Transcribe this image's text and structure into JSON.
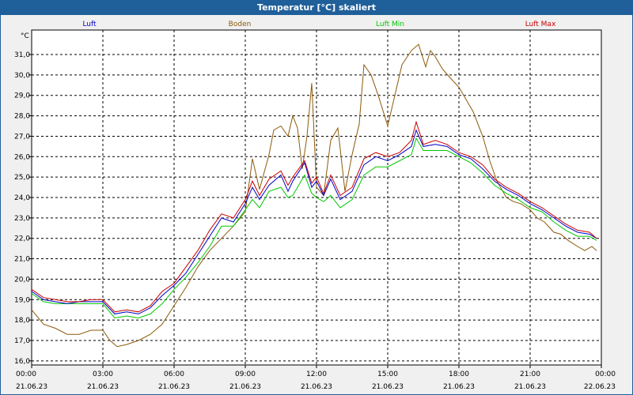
{
  "window": {
    "title": "Temperatur [°C] skaliert"
  },
  "chart_data": {
    "type": "line",
    "title": "Temperatur [°C] skaliert",
    "ylabel": "°C",
    "xlabel": "",
    "ylim": [
      15.8,
      32.2
    ],
    "xlim": [
      0,
      24
    ],
    "grid": true,
    "legend_placement": "top",
    "yticks": [
      "16,0",
      "17,0",
      "18,0",
      "19,0",
      "20,0",
      "21,0",
      "22,0",
      "23,0",
      "24,0",
      "25,0",
      "26,0",
      "27,0",
      "28,0",
      "29,0",
      "30,0",
      "31,0"
    ],
    "xticks": [
      {
        "time": "00:00",
        "date": "21.06.23",
        "h": 0
      },
      {
        "time": "03:00",
        "date": "21.06.23",
        "h": 3
      },
      {
        "time": "06:00",
        "date": "21.06.23",
        "h": 6
      },
      {
        "time": "09:00",
        "date": "21.06.23",
        "h": 9
      },
      {
        "time": "12:00",
        "date": "21.06.23",
        "h": 12
      },
      {
        "time": "15:00",
        "date": "21.06.23",
        "h": 15
      },
      {
        "time": "18:00",
        "date": "21.06.23",
        "h": 18
      },
      {
        "time": "21:00",
        "date": "21.06.23",
        "h": 21
      },
      {
        "time": "00:00",
        "date": "22.06.23",
        "h": 24
      }
    ],
    "series": [
      {
        "name": "Luft",
        "color": "#0000c8",
        "points": [
          [
            0,
            19.4
          ],
          [
            0.5,
            19.0
          ],
          [
            1,
            18.9
          ],
          [
            1.5,
            18.8
          ],
          [
            2,
            18.9
          ],
          [
            2.5,
            18.9
          ],
          [
            3,
            18.9
          ],
          [
            3.5,
            18.3
          ],
          [
            4,
            18.4
          ],
          [
            4.5,
            18.3
          ],
          [
            5,
            18.6
          ],
          [
            5.5,
            19.2
          ],
          [
            6,
            19.7
          ],
          [
            6.5,
            20.3
          ],
          [
            7,
            21.2
          ],
          [
            7.5,
            22.1
          ],
          [
            8,
            23.0
          ],
          [
            8.5,
            22.8
          ],
          [
            9,
            23.7
          ],
          [
            9.3,
            24.5
          ],
          [
            9.6,
            23.9
          ],
          [
            10,
            24.6
          ],
          [
            10.5,
            25.1
          ],
          [
            10.8,
            24.3
          ],
          [
            11,
            24.8
          ],
          [
            11.5,
            25.7
          ],
          [
            11.8,
            24.5
          ],
          [
            12,
            24.8
          ],
          [
            12.3,
            24.1
          ],
          [
            12.6,
            24.9
          ],
          [
            13,
            23.9
          ],
          [
            13.5,
            24.3
          ],
          [
            14,
            25.6
          ],
          [
            14.5,
            26.0
          ],
          [
            15,
            25.8
          ],
          [
            15.5,
            26.1
          ],
          [
            16,
            26.5
          ],
          [
            16.2,
            27.3
          ],
          [
            16.5,
            26.5
          ],
          [
            17,
            26.6
          ],
          [
            17.5,
            26.5
          ],
          [
            18,
            26.1
          ],
          [
            18.5,
            25.9
          ],
          [
            19,
            25.4
          ],
          [
            19.5,
            24.8
          ],
          [
            20,
            24.4
          ],
          [
            20.5,
            24.1
          ],
          [
            21,
            23.7
          ],
          [
            21.5,
            23.4
          ],
          [
            22,
            23.0
          ],
          [
            22.5,
            22.6
          ],
          [
            23,
            22.3
          ],
          [
            23.5,
            22.2
          ],
          [
            23.8,
            22.0
          ]
        ]
      },
      {
        "name": "Boden",
        "color": "#8b5a0a",
        "points": [
          [
            0,
            18.5
          ],
          [
            0.5,
            17.8
          ],
          [
            1,
            17.6
          ],
          [
            1.5,
            17.3
          ],
          [
            2,
            17.3
          ],
          [
            2.5,
            17.5
          ],
          [
            3,
            17.5
          ],
          [
            3.3,
            17.0
          ],
          [
            3.6,
            16.7
          ],
          [
            4,
            16.8
          ],
          [
            4.5,
            17.0
          ],
          [
            5,
            17.3
          ],
          [
            5.5,
            17.8
          ],
          [
            6,
            18.7
          ],
          [
            6.5,
            19.6
          ],
          [
            7,
            20.6
          ],
          [
            7.5,
            21.4
          ],
          [
            8,
            22.0
          ],
          [
            8.5,
            22.6
          ],
          [
            9,
            23.3
          ],
          [
            9.3,
            25.9
          ],
          [
            9.6,
            24.4
          ],
          [
            10,
            26.1
          ],
          [
            10.2,
            27.3
          ],
          [
            10.5,
            27.5
          ],
          [
            10.8,
            27.0
          ],
          [
            11,
            28.0
          ],
          [
            11.2,
            27.4
          ],
          [
            11.4,
            25.4
          ],
          [
            11.6,
            27.0
          ],
          [
            11.8,
            29.6
          ],
          [
            12,
            24.5
          ],
          [
            12.3,
            24.1
          ],
          [
            12.6,
            26.8
          ],
          [
            12.9,
            27.4
          ],
          [
            13.2,
            24.3
          ],
          [
            13.5,
            26.1
          ],
          [
            13.8,
            27.6
          ],
          [
            14,
            30.5
          ],
          [
            14.3,
            30.0
          ],
          [
            14.6,
            29.0
          ],
          [
            15,
            27.5
          ],
          [
            15.3,
            29.0
          ],
          [
            15.6,
            30.5
          ],
          [
            16,
            31.2
          ],
          [
            16.3,
            31.5
          ],
          [
            16.6,
            30.4
          ],
          [
            16.8,
            31.2
          ],
          [
            17.0,
            30.9
          ],
          [
            17.3,
            30.3
          ],
          [
            17.6,
            29.9
          ],
          [
            18,
            29.4
          ],
          [
            18.3,
            28.8
          ],
          [
            18.6,
            28.2
          ],
          [
            19,
            27.0
          ],
          [
            19.3,
            25.8
          ],
          [
            19.6,
            24.8
          ],
          [
            20,
            24.0
          ],
          [
            20.3,
            23.8
          ],
          [
            20.6,
            23.7
          ],
          [
            21,
            23.4
          ],
          [
            21.3,
            23.0
          ],
          [
            21.6,
            22.8
          ],
          [
            22,
            22.3
          ],
          [
            22.3,
            22.2
          ],
          [
            22.6,
            21.9
          ],
          [
            23,
            21.6
          ],
          [
            23.3,
            21.4
          ],
          [
            23.6,
            21.6
          ],
          [
            23.8,
            21.4
          ]
        ]
      },
      {
        "name": "Luft Min",
        "color": "#00c800",
        "points": [
          [
            0,
            19.3
          ],
          [
            0.5,
            18.9
          ],
          [
            1,
            18.8
          ],
          [
            1.5,
            18.8
          ],
          [
            2,
            18.8
          ],
          [
            2.5,
            18.8
          ],
          [
            3,
            18.8
          ],
          [
            3.5,
            18.1
          ],
          [
            4,
            18.2
          ],
          [
            4.5,
            18.1
          ],
          [
            5,
            18.3
          ],
          [
            5.5,
            18.8
          ],
          [
            6,
            19.5
          ],
          [
            6.5,
            20.1
          ],
          [
            7,
            20.8
          ],
          [
            7.5,
            21.6
          ],
          [
            8,
            22.6
          ],
          [
            8.5,
            22.6
          ],
          [
            9,
            23.4
          ],
          [
            9.3,
            23.9
          ],
          [
            9.6,
            23.5
          ],
          [
            10,
            24.3
          ],
          [
            10.5,
            24.5
          ],
          [
            10.8,
            24.0
          ],
          [
            11,
            24.1
          ],
          [
            11.5,
            25.1
          ],
          [
            11.8,
            24.2
          ],
          [
            12,
            24.0
          ],
          [
            12.3,
            23.8
          ],
          [
            12.6,
            24.1
          ],
          [
            13,
            23.5
          ],
          [
            13.5,
            23.9
          ],
          [
            14,
            25.1
          ],
          [
            14.5,
            25.5
          ],
          [
            15,
            25.5
          ],
          [
            15.5,
            25.8
          ],
          [
            16,
            26.1
          ],
          [
            16.2,
            26.9
          ],
          [
            16.5,
            26.3
          ],
          [
            17,
            26.3
          ],
          [
            17.5,
            26.3
          ],
          [
            18,
            26.0
          ],
          [
            18.5,
            25.7
          ],
          [
            19,
            25.2
          ],
          [
            19.5,
            24.6
          ],
          [
            20,
            24.2
          ],
          [
            20.5,
            23.9
          ],
          [
            21,
            23.5
          ],
          [
            21.5,
            23.3
          ],
          [
            22,
            22.8
          ],
          [
            22.5,
            22.4
          ],
          [
            23,
            22.1
          ],
          [
            23.5,
            22.1
          ],
          [
            23.8,
            21.9
          ]
        ]
      },
      {
        "name": "Luft Max",
        "color": "#c80000",
        "points": [
          [
            0,
            19.5
          ],
          [
            0.5,
            19.1
          ],
          [
            1,
            19.0
          ],
          [
            1.5,
            18.9
          ],
          [
            2,
            18.9
          ],
          [
            2.5,
            19.0
          ],
          [
            3,
            19.0
          ],
          [
            3.5,
            18.4
          ],
          [
            4,
            18.5
          ],
          [
            4.5,
            18.4
          ],
          [
            5,
            18.7
          ],
          [
            5.5,
            19.4
          ],
          [
            6,
            19.8
          ],
          [
            6.5,
            20.6
          ],
          [
            7,
            21.4
          ],
          [
            7.5,
            22.4
          ],
          [
            8,
            23.2
          ],
          [
            8.5,
            23.0
          ],
          [
            9,
            23.9
          ],
          [
            9.3,
            24.8
          ],
          [
            9.6,
            24.1
          ],
          [
            10,
            24.9
          ],
          [
            10.5,
            25.3
          ],
          [
            10.8,
            24.6
          ],
          [
            11,
            25.0
          ],
          [
            11.5,
            25.8
          ],
          [
            11.8,
            24.7
          ],
          [
            12,
            25.0
          ],
          [
            12.3,
            24.2
          ],
          [
            12.6,
            25.1
          ],
          [
            13,
            24.1
          ],
          [
            13.5,
            24.5
          ],
          [
            14,
            25.9
          ],
          [
            14.5,
            26.2
          ],
          [
            15,
            26.0
          ],
          [
            15.5,
            26.2
          ],
          [
            16,
            26.8
          ],
          [
            16.2,
            27.7
          ],
          [
            16.5,
            26.6
          ],
          [
            17,
            26.8
          ],
          [
            17.5,
            26.6
          ],
          [
            18,
            26.2
          ],
          [
            18.5,
            26.0
          ],
          [
            19,
            25.6
          ],
          [
            19.5,
            24.9
          ],
          [
            20,
            24.5
          ],
          [
            20.5,
            24.2
          ],
          [
            21,
            23.8
          ],
          [
            21.5,
            23.5
          ],
          [
            22,
            23.1
          ],
          [
            22.5,
            22.7
          ],
          [
            23,
            22.4
          ],
          [
            23.5,
            22.3
          ],
          [
            23.8,
            22.0
          ]
        ]
      }
    ]
  }
}
